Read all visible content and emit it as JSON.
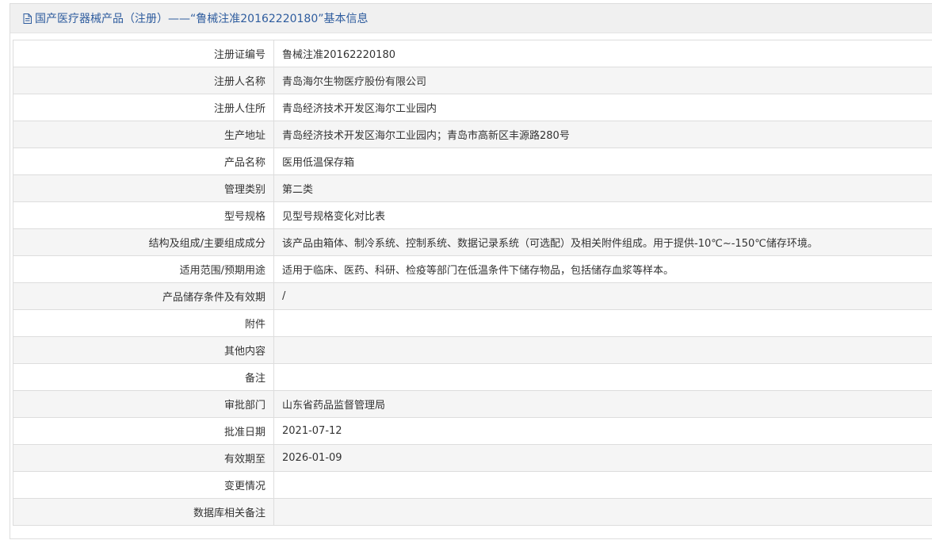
{
  "header": {
    "icon": "document-icon",
    "title": "国产医疗器械产品（注册）——“鲁械注准20162220180”基本信息"
  },
  "rows": [
    {
      "label": "注册证编号",
      "value": "鲁械注准20162220180"
    },
    {
      "label": "注册人名称",
      "value": "青岛海尔生物医疗股份有限公司"
    },
    {
      "label": "注册人住所",
      "value": "青岛经济技术开发区海尔工业园内"
    },
    {
      "label": "生产地址",
      "value": "青岛经济技术开发区海尔工业园内；青岛市高新区丰源路280号"
    },
    {
      "label": "产品名称",
      "value": "医用低温保存箱"
    },
    {
      "label": "管理类别",
      "value": "第二类"
    },
    {
      "label": "型号规格",
      "value": "见型号规格变化对比表"
    },
    {
      "label": "结构及组成/主要组成成分",
      "value": "该产品由箱体、制冷系统、控制系统、数据记录系统（可选配）及相关附件组成。用于提供-10℃~-150℃储存环境。"
    },
    {
      "label": "适用范围/预期用途",
      "value": "适用于临床、医药、科研、检疫等部门在低温条件下储存物品，包括储存血浆等样本。"
    },
    {
      "label": "产品储存条件及有效期",
      "value": "/"
    },
    {
      "label": "附件",
      "value": ""
    },
    {
      "label": "其他内容",
      "value": ""
    },
    {
      "label": "备注",
      "value": ""
    },
    {
      "label": "审批部门",
      "value": "山东省药品监督管理局"
    },
    {
      "label": "批准日期",
      "value": "2021-07-12"
    },
    {
      "label": "有效期至",
      "value": "2026-01-09"
    },
    {
      "label": "变更情况",
      "value": ""
    },
    {
      "label": "数据库相关备注",
      "value": ""
    }
  ],
  "colors": {
    "title": "#2e5c9e",
    "header_bg": "#f0f0f0",
    "row_alt_bg": "#f5f5f5",
    "border": "#dddddd"
  }
}
